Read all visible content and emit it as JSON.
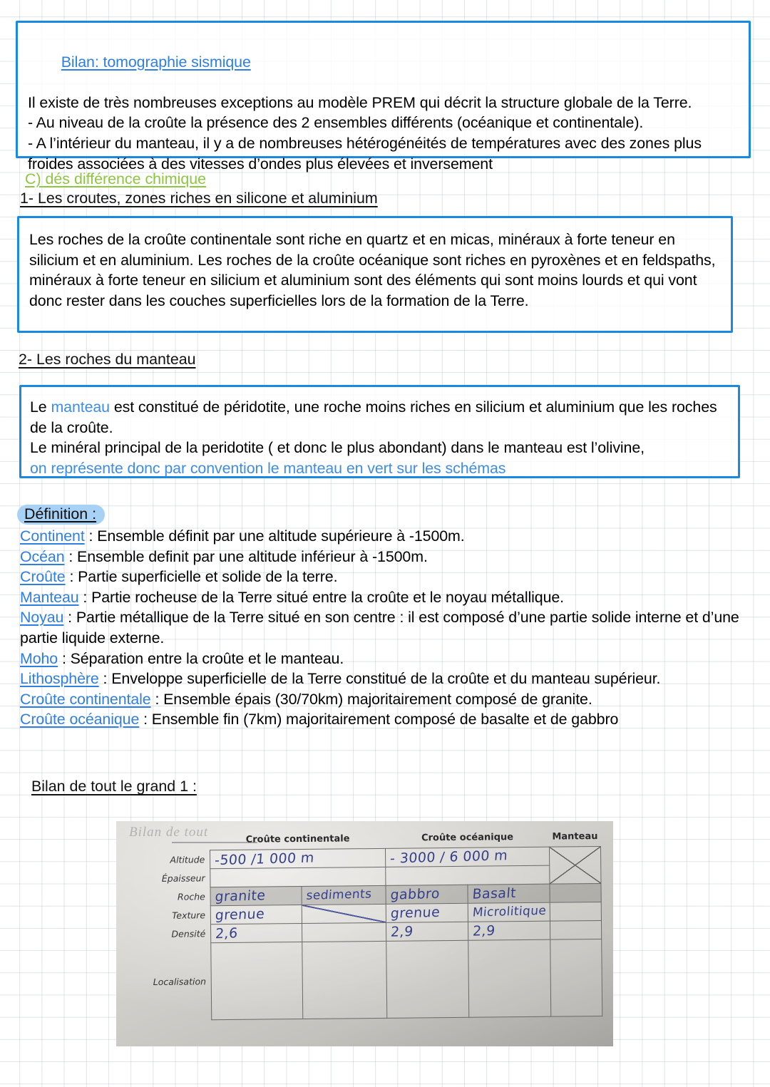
{
  "box_bilan": {
    "title": "Bilan: tomographie sismique",
    "lines": [
      "Il existe de très nombreuses exceptions au modèle PREM qui décrit la structure globale de la Terre.",
      "- Au niveau de la croûte la présence des 2 ensembles différents (océanique et continentale).",
      "- A l’intérieur du manteau, il y a de nombreuses hétérogénéités de températures avec des zones plus froides associées à des vitesses d’ondes plus élevées et inversement"
    ]
  },
  "heading_c": "C) dés différence chimique",
  "heading_1": "1- Les croutes, zones riches en silicone et aluminium",
  "box_croutes": {
    "text": "Les roches de la croûte continentale sont riche en quartz et en micas, minéraux à forte teneur en silicium et en aluminium. Les roches de la croûte océanique sont riches en pyroxènes et en feldspaths, minéraux à forte teneur en silicium et aluminium sont des éléments qui sont moins lourds et qui vont donc rester dans les couches superficielles lors de la formation de la Terre."
  },
  "heading_2": "2- Les roches du manteau",
  "box_manteau": {
    "seg1_a": "Le ",
    "seg1_b": "manteau",
    "seg1_c": " est constitué de péridotite, une roche moins riches en silicium et aluminium que les roches de la croûte.",
    "seg2": "Le minéral principal de la peridotite ( et donc le plus abondant) dans le manteau est l’olivine,",
    "seg3": "on représente donc par convention le manteau en vert sur les schémas"
  },
  "definitions": {
    "badge": "Définition :",
    "items": [
      {
        "term": "Continent",
        "text": " : Ensemble définit par une altitude supérieure à -1500m."
      },
      {
        "term": "Océan",
        "text": " : Ensemble definit par une altitude inférieur à -1500m."
      },
      {
        "term": "Croûte",
        "text": " : Partie superficielle et solide de la terre."
      },
      {
        "term": "Manteau",
        "text": " : Partie rocheuse de la Terre situé entre la croûte et le noyau métallique."
      },
      {
        "term": "Noyau",
        "text": " : Partie métallique de la Terre situé en son centre : il est composé d’une partie solide interne et d’une partie liquide externe."
      },
      {
        "term": "Moho",
        "text": " : Séparation entre la croûte et le manteau."
      },
      {
        "term": "Lithosphère",
        "text": " : Enveloppe superficielle de la Terre constitué de la croûte et du manteau supérieur."
      },
      {
        "term": "Croûte continentale",
        "text": " : Ensemble épais (30/70km) majoritairement composé de granite."
      },
      {
        "term": "Croûte océanique",
        "text": " : Ensemble fin (7km) majoritairement composé de basalte et de gabbro"
      }
    ]
  },
  "heading_bilan_grand1": "Bilan de tout le grand 1 :",
  "photo_table": {
    "ghost_title": "Bilan de tout",
    "col_headers": [
      "Croûte continentale",
      "Croûte océanique",
      "Manteau"
    ],
    "row_labels": [
      "Altitude",
      "Épaisseur",
      "Roche",
      "Texture",
      "Densité",
      "Localisation"
    ],
    "altitude": {
      "continentale": "-500 /1 000 m",
      "oceanique": "- 3000 / 6 000 m"
    },
    "epaisseur": {
      "continentale": "",
      "oceanique": ""
    },
    "roche": {
      "c1": "granite",
      "c2": "sediments",
      "c3": "gabbro",
      "c4": "Basalt"
    },
    "texture": {
      "c1": "grenue",
      "c2": "/",
      "c3": "grenue",
      "c4": "Microlitique"
    },
    "densite": {
      "c1": "2,6",
      "c2": "",
      "c3": "2,9",
      "c4": "2,9"
    },
    "localisation": {
      "c1": "",
      "c2": "",
      "c3": "",
      "c4": ""
    }
  },
  "colors": {
    "box_border": "#1a8ae0",
    "link_blue": "#2f7fe0",
    "text_blue": "#3d8ce8",
    "heading_green": "#8dc63f",
    "badge_bg": "#a8d2f5",
    "handwriting": "#35408c"
  }
}
